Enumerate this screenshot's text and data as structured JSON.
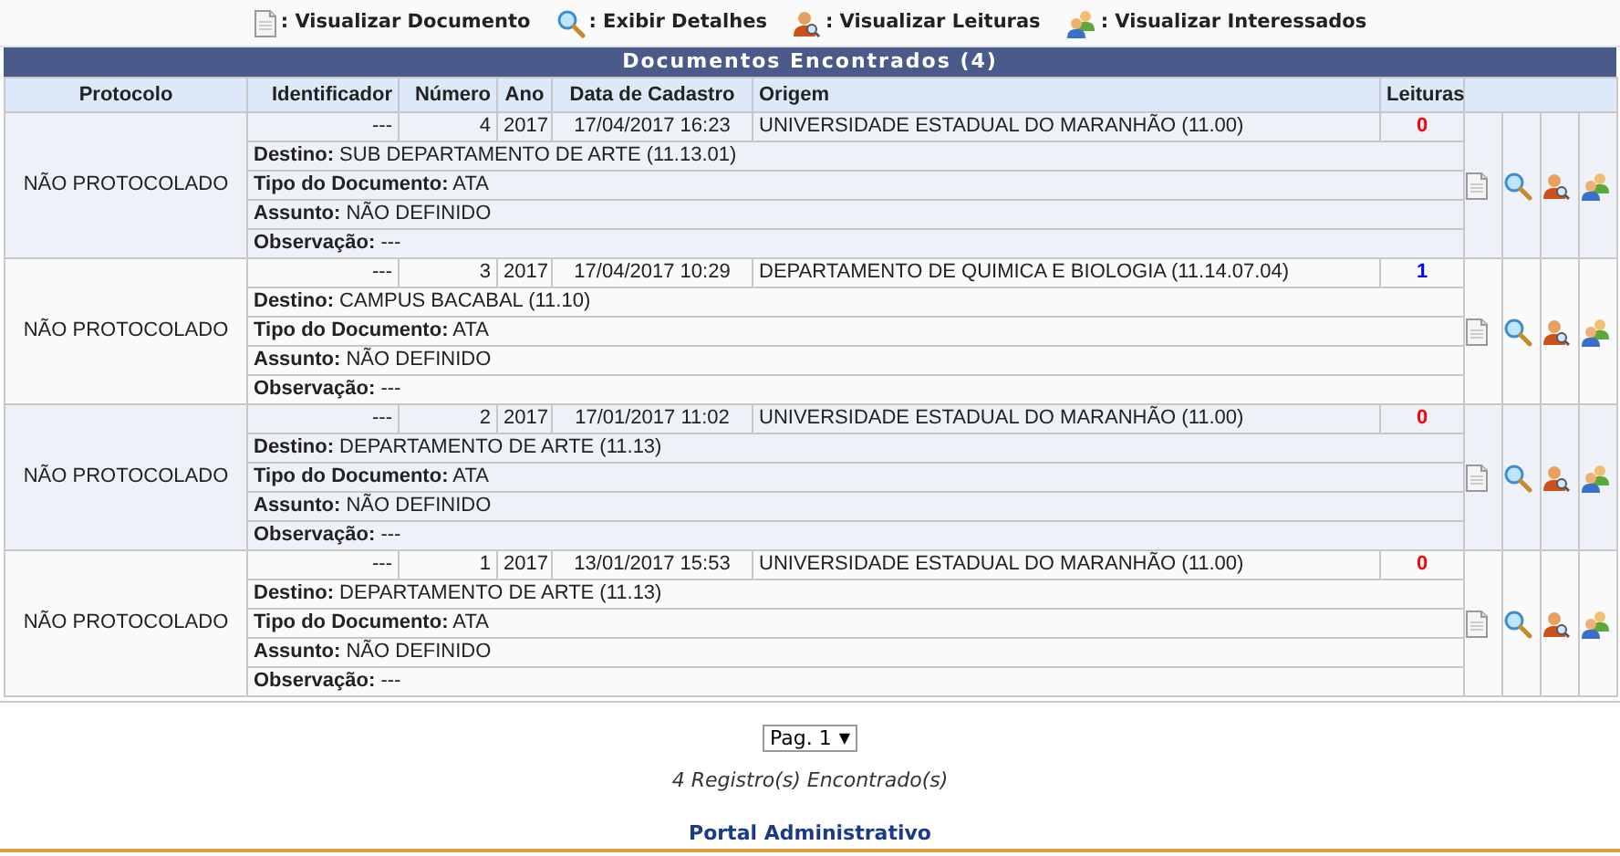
{
  "legend": [
    {
      "kind": "document",
      "label": ": Visualizar Documento"
    },
    {
      "kind": "search",
      "label": ": Exibir Detalhes"
    },
    {
      "kind": "reader",
      "label": ": Visualizar Leituras"
    },
    {
      "kind": "people",
      "label": ": Visualizar Interessados"
    }
  ],
  "table": {
    "title": "Documentos Encontrados (4)",
    "columns": [
      "Protocolo",
      "Identificador",
      "Número",
      "Ano",
      "Data de Cadastro",
      "Origem",
      "Leituras"
    ],
    "rows": [
      {
        "protocolo": "NÃO PROTOCOLADO",
        "identificador": "---",
        "numero": "4",
        "ano": "2017",
        "data": "17/04/2017 16:23",
        "origem": "UNIVERSIDADE ESTADUAL DO MARANHÃO (11.00)",
        "leituras": "0",
        "color": "#ff0000",
        "details": [
          "**Destino:** SUB DEPARTAMENTO DE ARTE (11.13.01)",
          "**Tipo do Documento:** ATA",
          "**Assunto:** NÃO DEFINIDO",
          "**Observação:** ---"
        ]
      },
      {
        "protocolo": "NÃO PROTOCOLADO",
        "identificador": "---",
        "numero": "3",
        "ano": "2017",
        "data": "17/04/2017 10:29",
        "origem": "DEPARTAMENTO DE QUIMICA E BIOLOGIA (11.14.07.04)",
        "leituras": "1",
        "color": "#0000ff",
        "details": [
          "**Destino:** CAMPUS BACABAL (11.10)",
          "**Tipo do Documento:** ATA",
          "**Assunto:** NÃO DEFINIDO",
          "**Observação:** ---"
        ]
      },
      {
        "protocolo": "NÃO PROTOCOLADO",
        "identificador": "---",
        "numero": "2",
        "ano": "2017",
        "data": "17/01/2017 11:02",
        "origem": "UNIVERSIDADE ESTADUAL DO MARANHÃO (11.00)",
        "leituras": "0",
        "color": "#ff0000",
        "details": [
          "**Destino:** DEPARTAMENTO DE ARTE (11.13)",
          "**Tipo do Documento:** ATA",
          "**Assunto:** NÃO DEFINIDO",
          "**Observação:** ---"
        ]
      },
      {
        "protocolo": "NÃO PROTOCOLADO",
        "identificador": "---",
        "numero": "1",
        "ano": "2017",
        "data": "13/01/2017 15:53",
        "origem": "UNIVERSIDADE ESTADUAL DO MARANHÃO (11.00)",
        "leituras": "0",
        "color": "#ff0000",
        "details": [
          "**Destino:** DEPARTAMENTO DE ARTE (11.13)",
          "**Tipo do Documento:** ATA",
          "**Assunto:** NÃO DEFINIDO",
          "**Observação:** ---"
        ]
      }
    ]
  },
  "pagination": {
    "value": "Pag. 1",
    "caret": "▼"
  },
  "records": "4 Registro(s) Encontrado(s)",
  "footer_link": "Portal Administrativo"
}
